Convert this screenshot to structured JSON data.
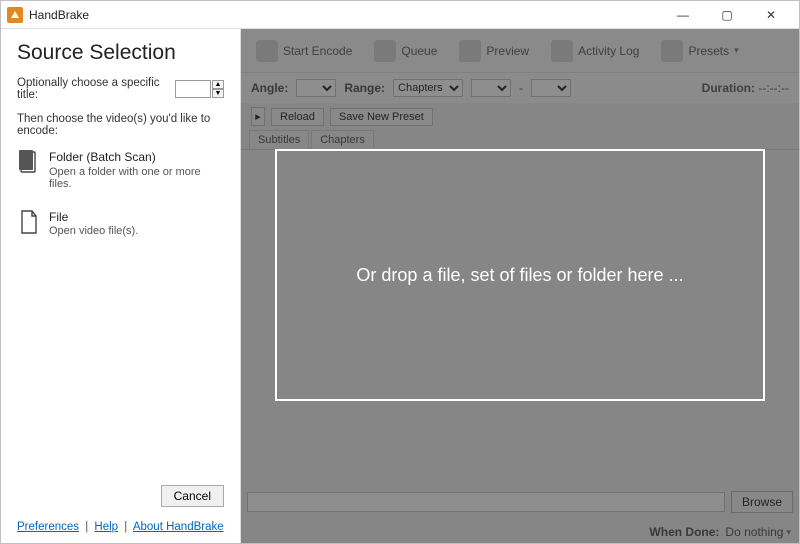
{
  "titlebar": {
    "app_name": "HandBrake"
  },
  "win_controls": {
    "minimize_icon": "—",
    "maximize_icon": "▢",
    "close_icon": "✕"
  },
  "sidebar": {
    "heading": "Source Selection",
    "optional_title_label": "Optionally choose a specific title:",
    "optional_title_value": "",
    "choose_videos_label": "Then choose the video(s) you'd like to encode:",
    "folder": {
      "title": "Folder (Batch Scan)",
      "sub": "Open a folder with one or more files."
    },
    "file": {
      "title": "File",
      "sub": "Open video file(s)."
    },
    "cancel_label": "Cancel",
    "links": {
      "preferences": "Preferences",
      "help": "Help",
      "about": "About HandBrake"
    }
  },
  "dropzone": {
    "text": "Or drop a file, set of files or folder here ..."
  },
  "toolbar": {
    "start_encode": "Start Encode",
    "queue": "Queue",
    "preview": "Preview",
    "activity_log": "Activity Log",
    "presets": "Presets"
  },
  "ribbon": {
    "angle_label": "Angle:",
    "range_label": "Range:",
    "range_mode": "Chapters",
    "range_sep": "-",
    "duration_label": "Duration:",
    "duration_value": "--:--:--"
  },
  "preset_row": {
    "reload": "Reload",
    "save_new": "Save New Preset"
  },
  "tabs": {
    "subtitles": "Subtitles",
    "chapters": "Chapters"
  },
  "dest": {
    "browse": "Browse"
  },
  "status": {
    "when_done_label": "When Done:",
    "when_done_value": "Do nothing"
  }
}
